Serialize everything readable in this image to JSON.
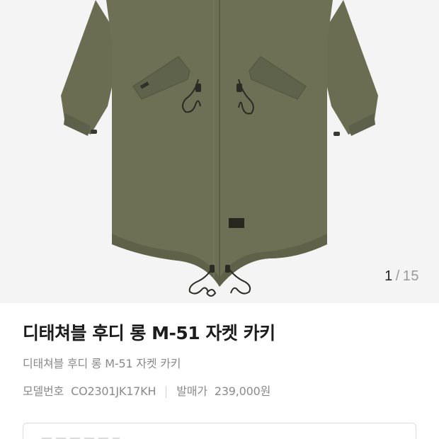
{
  "gallery": {
    "current": "1",
    "separator": "/",
    "total": "15",
    "image_alt": "jacket-photo"
  },
  "product": {
    "title": "디태쳐블 후디 롱 M-51 자켓 카키",
    "subtitle": "디태쳐블 후디 롱 M-51 자켓 카키",
    "model_label": "모델번호",
    "model_value": "CO2301JK17KH",
    "price_label": "발매가",
    "price_value": "239,000원"
  },
  "colors": {
    "jacket": "#6b6e52",
    "background": "#f4f4f4"
  }
}
